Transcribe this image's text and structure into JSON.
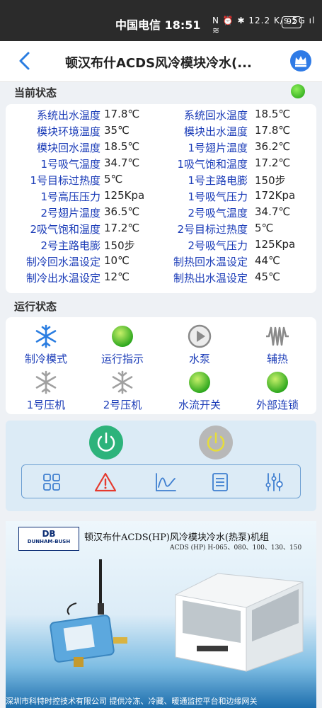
{
  "statusbar": {
    "carrier_time": "中国电信 18:51",
    "icons_text": "N ⏰ ✱ 12.2 K/s 5G ıl ≋",
    "battery": "92"
  },
  "header": {
    "title": "顿汉布什ACDS风冷模块冷水(..."
  },
  "current_status": {
    "title": "当前状态",
    "rows": [
      {
        "l1": "系统出水温度",
        "v1": "17.8℃",
        "l2": "系统回水温度",
        "v2": "18.5℃"
      },
      {
        "l1": "模块环境温度",
        "v1": "35℃",
        "l2": "模块出水温度",
        "v2": "17.8℃"
      },
      {
        "l1": "模块回水温度",
        "v1": "18.5℃",
        "l2": "1号翅片温度",
        "v2": "36.2℃"
      },
      {
        "l1": "1号吸气温度",
        "v1": "34.7℃",
        "l2": "1吸气饱和温度",
        "v2": "17.2℃"
      },
      {
        "l1": "1号目标过热度",
        "v1": "5℃",
        "l2": "1号主路电膨",
        "v2": "150步"
      },
      {
        "l1": "1号高压压力",
        "v1": "125Kpa",
        "l2": "1号吸气压力",
        "v2": "172Kpa"
      },
      {
        "l1": "2号翅片温度",
        "v1": "36.5℃",
        "l2": "2号吸气温度",
        "v2": "34.7℃"
      },
      {
        "l1": "2吸气饱和温度",
        "v1": "17.2℃",
        "l2": "2号目标过热度",
        "v2": "5℃"
      },
      {
        "l1": "2号主路电膨",
        "v1": "150步",
        "l2": "2号吸气压力",
        "v2": "125Kpa"
      },
      {
        "l1": "制冷回水温设定",
        "v1": "10℃",
        "l2": "制热回水温设定",
        "v2": "44℃"
      },
      {
        "l1": "制冷出水温设定",
        "v1": "12℃",
        "l2": "制热出水温设定",
        "v2": "45℃"
      }
    ]
  },
  "run_status": {
    "title": "运行状态",
    "items": [
      {
        "label": "制冷模式",
        "icon": "snowflake-icon",
        "state": "active"
      },
      {
        "label": "运行指示",
        "icon": "green-light-icon",
        "state": "active"
      },
      {
        "label": "水泵",
        "icon": "play-icon",
        "state": "inactive"
      },
      {
        "label": "辅热",
        "icon": "heater-icon",
        "state": "inactive"
      },
      {
        "label": "1号压机",
        "icon": "snowflake-icon",
        "state": "inactive"
      },
      {
        "label": "2号压机",
        "icon": "snowflake-icon",
        "state": "inactive"
      },
      {
        "label": "水流开关",
        "icon": "green-light-icon",
        "state": "active"
      },
      {
        "label": "外部连锁",
        "icon": "green-light-icon",
        "state": "active"
      }
    ]
  },
  "colors": {
    "accent": "#2a7de1",
    "label_blue": "#1c3db8",
    "green": "#3eb626",
    "power_on": "#2db37b",
    "power_off": "#b8b8b8",
    "warning": "#e53a2e"
  },
  "banner": {
    "logo_top": "DB",
    "logo_bottom": "DUNHAM-BUSH",
    "headline": "顿汉布什ACDS(HP)风冷模块冷水(热泵)机组",
    "subline": "ACDS (HP) H-065、080、100、130、150",
    "footer": "深圳市科特时控技术有限公司     提供冷冻、冷藏、暖通监控平台和边缘网关"
  }
}
